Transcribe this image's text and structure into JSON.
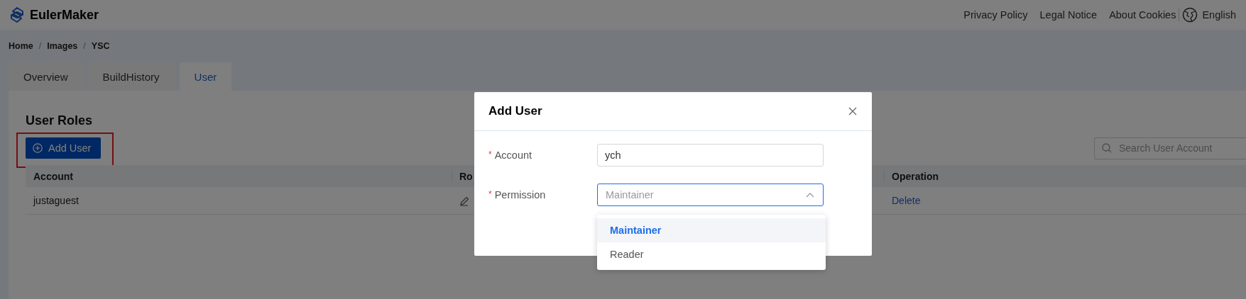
{
  "header": {
    "logo": "EulerMaker",
    "links": [
      "Privacy Policy",
      "Legal Notice",
      "About Cookies"
    ],
    "language": "English"
  },
  "breadcrumb": [
    {
      "label": "Home",
      "separator": "/"
    },
    {
      "label": "Images",
      "separator": "/"
    },
    {
      "label": "YSC"
    }
  ],
  "tabs": [
    {
      "label": "Overview",
      "selected": false
    },
    {
      "label": "BuildHistory",
      "selected": false
    },
    {
      "label": "User",
      "selected": true
    }
  ],
  "section_title": "User Roles",
  "add_button": {
    "label": "Add User",
    "highlighted": true
  },
  "search": {
    "placeholder": "Search User Account"
  },
  "table": {
    "columns": [
      "Account",
      "Ro",
      "Operation"
    ],
    "rows": [
      {
        "account": "justaguest",
        "operation": "Delete"
      }
    ]
  },
  "dialog": {
    "title": "Add User",
    "fields": [
      {
        "kind": "input",
        "label": "Account",
        "required_mark": "*",
        "value": "ych"
      },
      {
        "kind": "select",
        "label": "Permission",
        "required_mark": "*",
        "placeholder": "Maintainer",
        "expanded": true,
        "options": [
          {
            "label": "Maintainer",
            "selected": true
          },
          {
            "label": "Reader",
            "selected": false
          }
        ]
      }
    ]
  }
}
